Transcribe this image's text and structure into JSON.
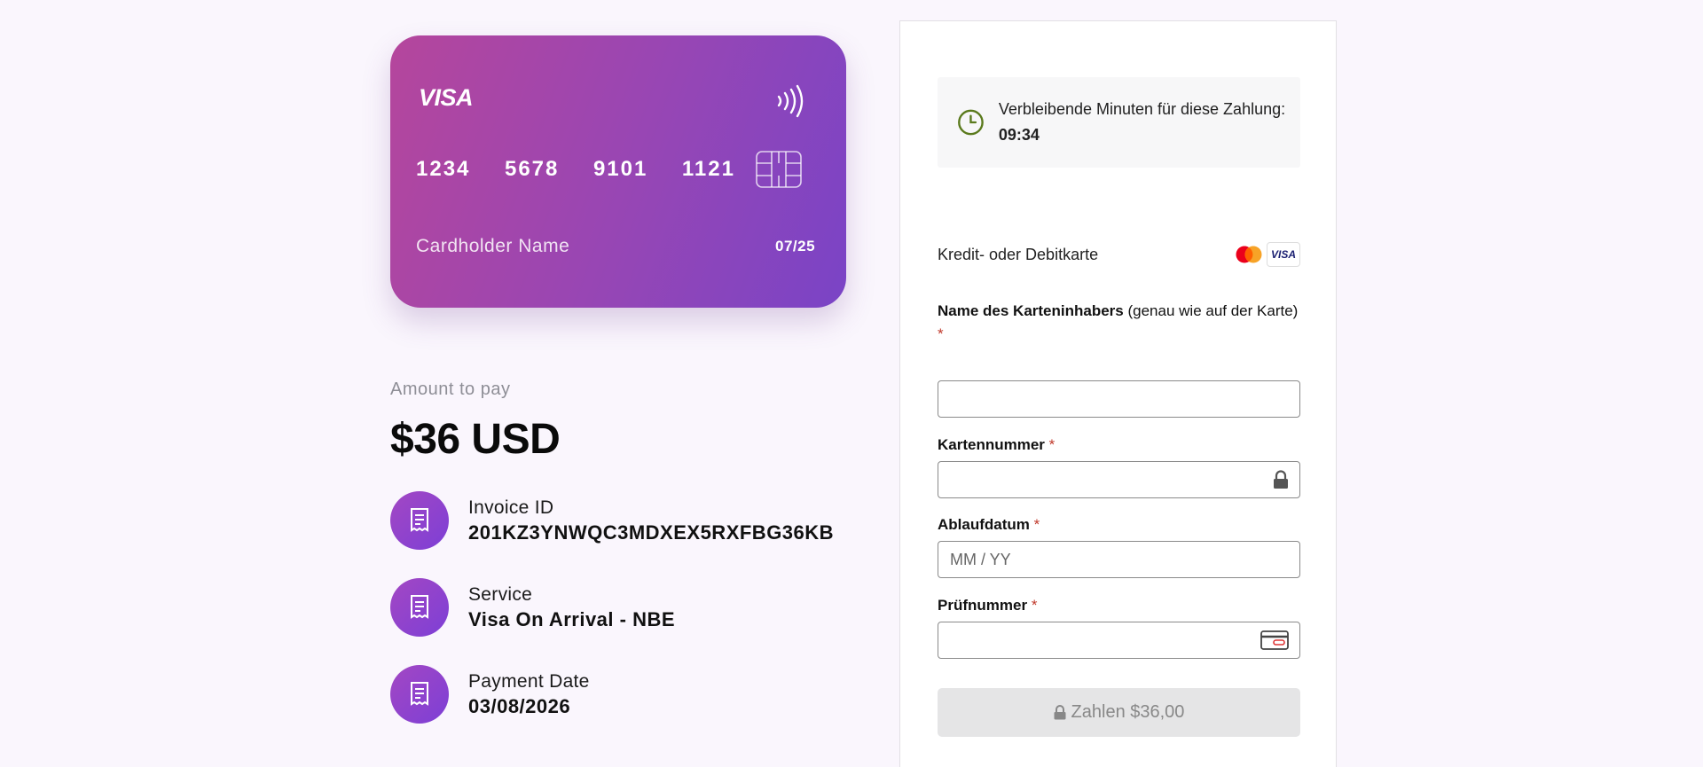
{
  "card": {
    "brand": "VISA",
    "number_groups": [
      "1234",
      "5678",
      "9101",
      "1121"
    ],
    "holder": "Cardholder Name",
    "expiry": "07/25"
  },
  "amount": {
    "label": "Amount to pay",
    "value": "$36 USD"
  },
  "details": [
    {
      "label": "Invoice ID",
      "value": "201KZ3YNWQC3MDXEX5RXFBG36KB",
      "icon": "receipt-icon"
    },
    {
      "label": "Service",
      "value": "Visa On Arrival - NBE",
      "icon": "receipt-icon"
    },
    {
      "label": "Payment Date",
      "value": "03/08/2026",
      "icon": "receipt-icon"
    }
  ],
  "payment": {
    "timer_text": "Verbleibende Minuten für diese Zahlung:",
    "timer_value": "09:34",
    "method_label": "Kredit- oder Debitkarte",
    "logos": [
      "mastercard-logo",
      "visa-logo"
    ],
    "visa_logo_text": "VISA",
    "fields": {
      "holder_label": "Name des Karteninhabers",
      "holder_hint": "(genau wie auf der Karte)",
      "holder_value": "",
      "number_label": "Kartennummer",
      "number_value": "",
      "expiry_label": "Ablaufdatum",
      "expiry_placeholder": "MM / YY",
      "cvc_label": "Prüfnummer",
      "cvc_value": "",
      "required_mark": "*"
    },
    "pay_button": "Zahlen $36,00"
  },
  "colors": {
    "background": "#faf6fd",
    "card_gradient_start": "#b5469c",
    "card_gradient_end": "#7a44c6",
    "timer_icon": "#5a7a1c",
    "required": "#c0392b",
    "button_disabled": "#e5e5e6"
  }
}
